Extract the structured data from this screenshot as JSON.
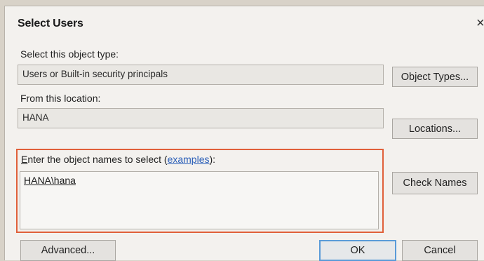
{
  "dialog": {
    "title": "Select Users",
    "close_glyph": "×"
  },
  "object_type": {
    "label": "Select this object type:",
    "value": "Users or Built-in security principals",
    "button": "Object Types..."
  },
  "location": {
    "label": "From this location:",
    "value": "HANA",
    "button": "Locations..."
  },
  "names": {
    "label_mnemonic": "E",
    "label_rest": "nter the object names to select (",
    "examples_link": "examples",
    "label_end": "):",
    "value": "HANA\\hana",
    "check_button": "Check Names"
  },
  "footer": {
    "advanced": "Advanced...",
    "ok": "OK",
    "cancel": "Cancel"
  },
  "colors": {
    "highlight_border": "#e0603a",
    "link": "#2b5fb8",
    "default_button_border": "#5a9bd8"
  }
}
